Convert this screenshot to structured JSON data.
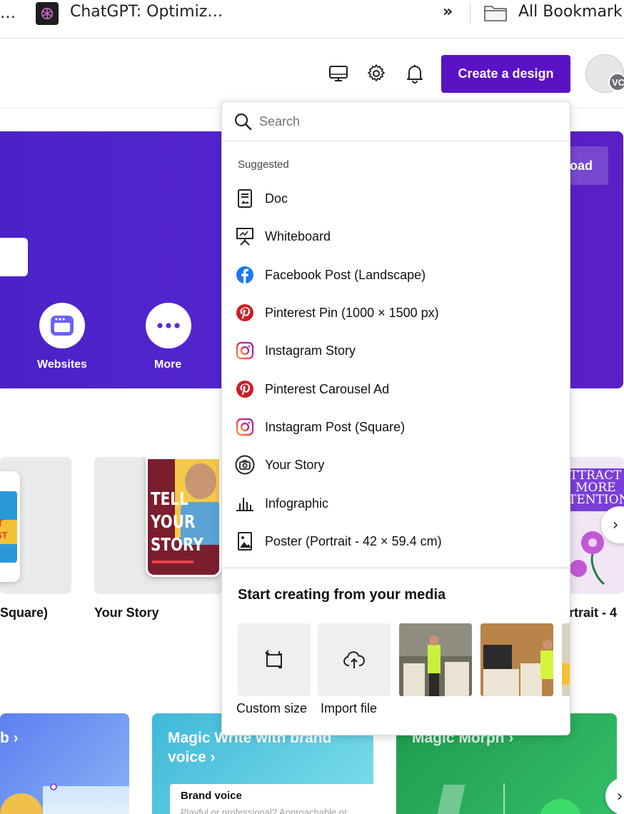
{
  "bookmarks_bar": {
    "overflow_left": "…",
    "tab_title": "ChatGPT: Optimiz…",
    "chevrons": "»",
    "all_bookmarks": "All Bookmark"
  },
  "header": {
    "icons": [
      "desktop-icon",
      "gear-icon",
      "bell-icon"
    ],
    "create_button": "Create a design",
    "avatar_initials": "VC",
    "brand_color": "#5a12c4"
  },
  "hero": {
    "upload_label_partial": "oad",
    "quick_links": [
      {
        "label": "Websites",
        "icon": "website-icon"
      },
      {
        "label": "More",
        "icon": "more-dots-icon"
      }
    ],
    "gradient_colors": [
      "#4b22c8",
      "#5a20c4"
    ]
  },
  "cards": [
    {
      "label": "Square)",
      "art_text": [
        "T",
        "ST"
      ]
    },
    {
      "label": "Your Story",
      "art_text": [
        "TELL",
        "YOUR",
        "STORY"
      ]
    },
    {
      "label": "ortrait - 4",
      "art_text": [
        "TTRACT",
        "MORE",
        "TENTION"
      ]
    }
  ],
  "feature_tiles": [
    {
      "title": "b ›"
    },
    {
      "title_line1": "Magic Write with brand",
      "title_line2": "voice ›",
      "inner_label": "Brand voice",
      "inner_subtext": "Playful or professional? Approachable or"
    },
    {
      "title": "Magic Morph ›"
    }
  ],
  "dropdown": {
    "search_placeholder": "Search",
    "suggested_heading": "Suggested",
    "items": [
      {
        "label": "Doc",
        "icon": "doc-icon"
      },
      {
        "label": "Whiteboard",
        "icon": "whiteboard-icon"
      },
      {
        "label": "Facebook Post (Landscape)",
        "icon": "facebook-icon"
      },
      {
        "label": "Pinterest Pin (1000 × 1500 px)",
        "icon": "pinterest-icon"
      },
      {
        "label": "Instagram Story",
        "icon": "instagram-icon"
      },
      {
        "label": "Pinterest Carousel Ad",
        "icon": "pinterest-icon"
      },
      {
        "label": "Instagram Post (Square)",
        "icon": "instagram-icon"
      },
      {
        "label": "Your Story",
        "icon": "camera-icon"
      },
      {
        "label": "Infographic",
        "icon": "bar-chart-icon"
      },
      {
        "label": "Poster (Portrait - 42 × 59.4 cm)",
        "icon": "poster-icon"
      }
    ],
    "media_heading": "Start creating from your media",
    "media_actions": [
      {
        "label": "Custom size",
        "icon": "resize-icon"
      },
      {
        "label": "Import file",
        "icon": "cloud-upload-icon"
      }
    ],
    "thumbnail_count": 3
  }
}
